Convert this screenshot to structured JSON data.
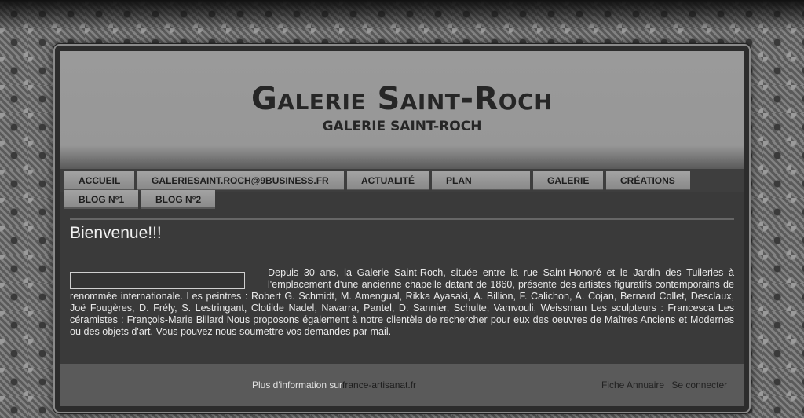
{
  "site": {
    "title": "Galerie Saint-Roch",
    "subtitle": "GALERIE SAINT-ROCH"
  },
  "nav": {
    "tabs": [
      {
        "label": "ACCUEIL"
      },
      {
        "label": "GALERIESAINT.ROCH@9BUSINESS.FR"
      },
      {
        "label": "ACTUALITÉ"
      },
      {
        "label": "PLAN"
      },
      {
        "label": "GALERIE"
      },
      {
        "label": "CRÉATIONS"
      },
      {
        "label": "BLOG N°1"
      },
      {
        "label": "BLOG N°2"
      }
    ]
  },
  "main": {
    "heading": "Bienvenue!!!",
    "paragraph": "Depuis 30 ans, la Galerie Saint-Roch, située entre la rue Saint-Honoré et le Jardin des Tuileries à l'emplacement d'une ancienne chapelle datant de 1860, présente des artistes figuratifs contemporains de renommée internationale. Les peintres : Robert G. Schmidt, M. Amengual, Rikka Ayasaki, A. Billion, F. Calichon, A. Cojan, Bernard Collet, Desclaux, Joë Fougères, D. Frély, S. Lestringant, Clotilde Nadel, Navarra, Pantel, D. Sannier, Schulte, Vamvouli, Weissman Les sculpteurs : Francesca Les céramistes : François-Marie Billard Nous proposons également à notre clientèle de rechercher pour eux des oeuvres de Maîtres Anciens et Modernes ou des objets d'art. Vous pouvez nous soumettre vos demandes par mail."
  },
  "footer": {
    "info_prefix": "Plus d'information sur",
    "info_link": "france-artisanat.fr",
    "links": [
      "Fiche Annuaire",
      "Se connecter"
    ]
  }
}
